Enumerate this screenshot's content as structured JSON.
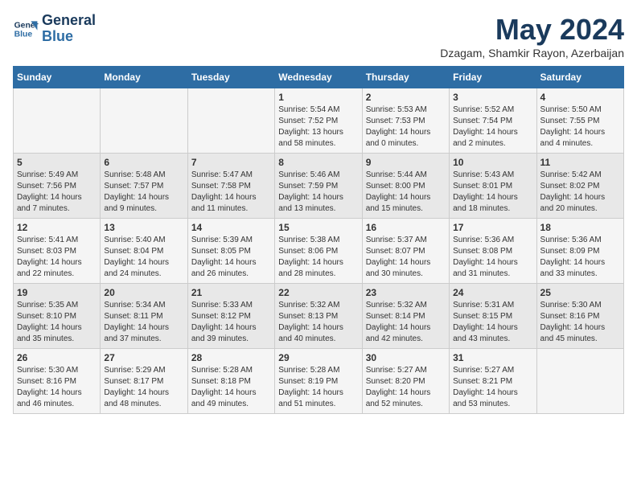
{
  "logo": {
    "line1": "General",
    "line2": "Blue"
  },
  "title": "May 2024",
  "location": "Dzagam, Shamkir Rayon, Azerbaijan",
  "headers": [
    "Sunday",
    "Monday",
    "Tuesday",
    "Wednesday",
    "Thursday",
    "Friday",
    "Saturday"
  ],
  "weeks": [
    [
      {
        "day": "",
        "info": ""
      },
      {
        "day": "",
        "info": ""
      },
      {
        "day": "",
        "info": ""
      },
      {
        "day": "1",
        "info": "Sunrise: 5:54 AM\nSunset: 7:52 PM\nDaylight: 13 hours\nand 58 minutes."
      },
      {
        "day": "2",
        "info": "Sunrise: 5:53 AM\nSunset: 7:53 PM\nDaylight: 14 hours\nand 0 minutes."
      },
      {
        "day": "3",
        "info": "Sunrise: 5:52 AM\nSunset: 7:54 PM\nDaylight: 14 hours\nand 2 minutes."
      },
      {
        "day": "4",
        "info": "Sunrise: 5:50 AM\nSunset: 7:55 PM\nDaylight: 14 hours\nand 4 minutes."
      }
    ],
    [
      {
        "day": "5",
        "info": "Sunrise: 5:49 AM\nSunset: 7:56 PM\nDaylight: 14 hours\nand 7 minutes."
      },
      {
        "day": "6",
        "info": "Sunrise: 5:48 AM\nSunset: 7:57 PM\nDaylight: 14 hours\nand 9 minutes."
      },
      {
        "day": "7",
        "info": "Sunrise: 5:47 AM\nSunset: 7:58 PM\nDaylight: 14 hours\nand 11 minutes."
      },
      {
        "day": "8",
        "info": "Sunrise: 5:46 AM\nSunset: 7:59 PM\nDaylight: 14 hours\nand 13 minutes."
      },
      {
        "day": "9",
        "info": "Sunrise: 5:44 AM\nSunset: 8:00 PM\nDaylight: 14 hours\nand 15 minutes."
      },
      {
        "day": "10",
        "info": "Sunrise: 5:43 AM\nSunset: 8:01 PM\nDaylight: 14 hours\nand 18 minutes."
      },
      {
        "day": "11",
        "info": "Sunrise: 5:42 AM\nSunset: 8:02 PM\nDaylight: 14 hours\nand 20 minutes."
      }
    ],
    [
      {
        "day": "12",
        "info": "Sunrise: 5:41 AM\nSunset: 8:03 PM\nDaylight: 14 hours\nand 22 minutes."
      },
      {
        "day": "13",
        "info": "Sunrise: 5:40 AM\nSunset: 8:04 PM\nDaylight: 14 hours\nand 24 minutes."
      },
      {
        "day": "14",
        "info": "Sunrise: 5:39 AM\nSunset: 8:05 PM\nDaylight: 14 hours\nand 26 minutes."
      },
      {
        "day": "15",
        "info": "Sunrise: 5:38 AM\nSunset: 8:06 PM\nDaylight: 14 hours\nand 28 minutes."
      },
      {
        "day": "16",
        "info": "Sunrise: 5:37 AM\nSunset: 8:07 PM\nDaylight: 14 hours\nand 30 minutes."
      },
      {
        "day": "17",
        "info": "Sunrise: 5:36 AM\nSunset: 8:08 PM\nDaylight: 14 hours\nand 31 minutes."
      },
      {
        "day": "18",
        "info": "Sunrise: 5:36 AM\nSunset: 8:09 PM\nDaylight: 14 hours\nand 33 minutes."
      }
    ],
    [
      {
        "day": "19",
        "info": "Sunrise: 5:35 AM\nSunset: 8:10 PM\nDaylight: 14 hours\nand 35 minutes."
      },
      {
        "day": "20",
        "info": "Sunrise: 5:34 AM\nSunset: 8:11 PM\nDaylight: 14 hours\nand 37 minutes."
      },
      {
        "day": "21",
        "info": "Sunrise: 5:33 AM\nSunset: 8:12 PM\nDaylight: 14 hours\nand 39 minutes."
      },
      {
        "day": "22",
        "info": "Sunrise: 5:32 AM\nSunset: 8:13 PM\nDaylight: 14 hours\nand 40 minutes."
      },
      {
        "day": "23",
        "info": "Sunrise: 5:32 AM\nSunset: 8:14 PM\nDaylight: 14 hours\nand 42 minutes."
      },
      {
        "day": "24",
        "info": "Sunrise: 5:31 AM\nSunset: 8:15 PM\nDaylight: 14 hours\nand 43 minutes."
      },
      {
        "day": "25",
        "info": "Sunrise: 5:30 AM\nSunset: 8:16 PM\nDaylight: 14 hours\nand 45 minutes."
      }
    ],
    [
      {
        "day": "26",
        "info": "Sunrise: 5:30 AM\nSunset: 8:16 PM\nDaylight: 14 hours\nand 46 minutes."
      },
      {
        "day": "27",
        "info": "Sunrise: 5:29 AM\nSunset: 8:17 PM\nDaylight: 14 hours\nand 48 minutes."
      },
      {
        "day": "28",
        "info": "Sunrise: 5:28 AM\nSunset: 8:18 PM\nDaylight: 14 hours\nand 49 minutes."
      },
      {
        "day": "29",
        "info": "Sunrise: 5:28 AM\nSunset: 8:19 PM\nDaylight: 14 hours\nand 51 minutes."
      },
      {
        "day": "30",
        "info": "Sunrise: 5:27 AM\nSunset: 8:20 PM\nDaylight: 14 hours\nand 52 minutes."
      },
      {
        "day": "31",
        "info": "Sunrise: 5:27 AM\nSunset: 8:21 PM\nDaylight: 14 hours\nand 53 minutes."
      },
      {
        "day": "",
        "info": ""
      }
    ]
  ]
}
